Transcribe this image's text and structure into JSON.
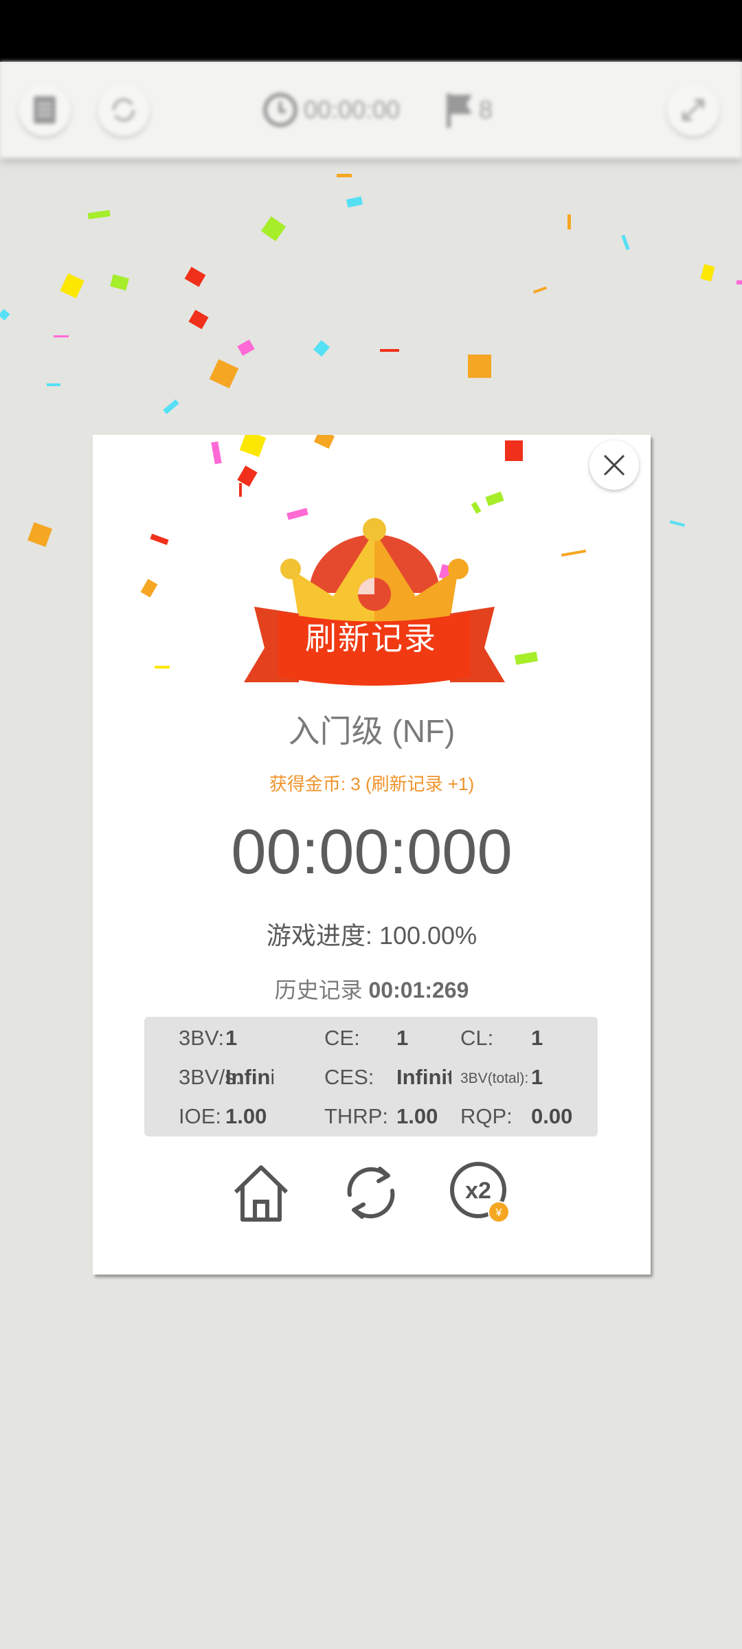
{
  "toolbar": {
    "timer": "00:00:00",
    "flags": "8"
  },
  "dialog": {
    "banner": "刷新记录",
    "level": "入门级 (NF)",
    "coins": "获得金币: 3 (刷新记录 +1)",
    "time": "00:00:000",
    "progress_label": "游戏进度:",
    "progress_value": "100.00%",
    "history_label": "历史记录",
    "history_value": "00:01:269",
    "stats": [
      {
        "label": "3BV:",
        "value": "1"
      },
      {
        "label": "CE:",
        "value": "1"
      },
      {
        "label": "CL:",
        "value": "1"
      },
      {
        "label": "3BV/s:",
        "value": "Infini"
      },
      {
        "label": "CES:",
        "value": "Infinit"
      },
      {
        "label": "3BV(total):",
        "value": "1"
      },
      {
        "label": "IOE:",
        "value": "1.00"
      },
      {
        "label": "THRP:",
        "value": "1.00"
      },
      {
        "label": "RQP:",
        "value": "0.00"
      }
    ],
    "actions": {
      "home": "home-icon",
      "restart": "refresh-icon",
      "double": "x2"
    }
  },
  "colors": {
    "background": "#e4e4e1",
    "accent_orange": "#f0932b",
    "banner_red": "#e8401f",
    "crown_gold": "#f7c531"
  }
}
